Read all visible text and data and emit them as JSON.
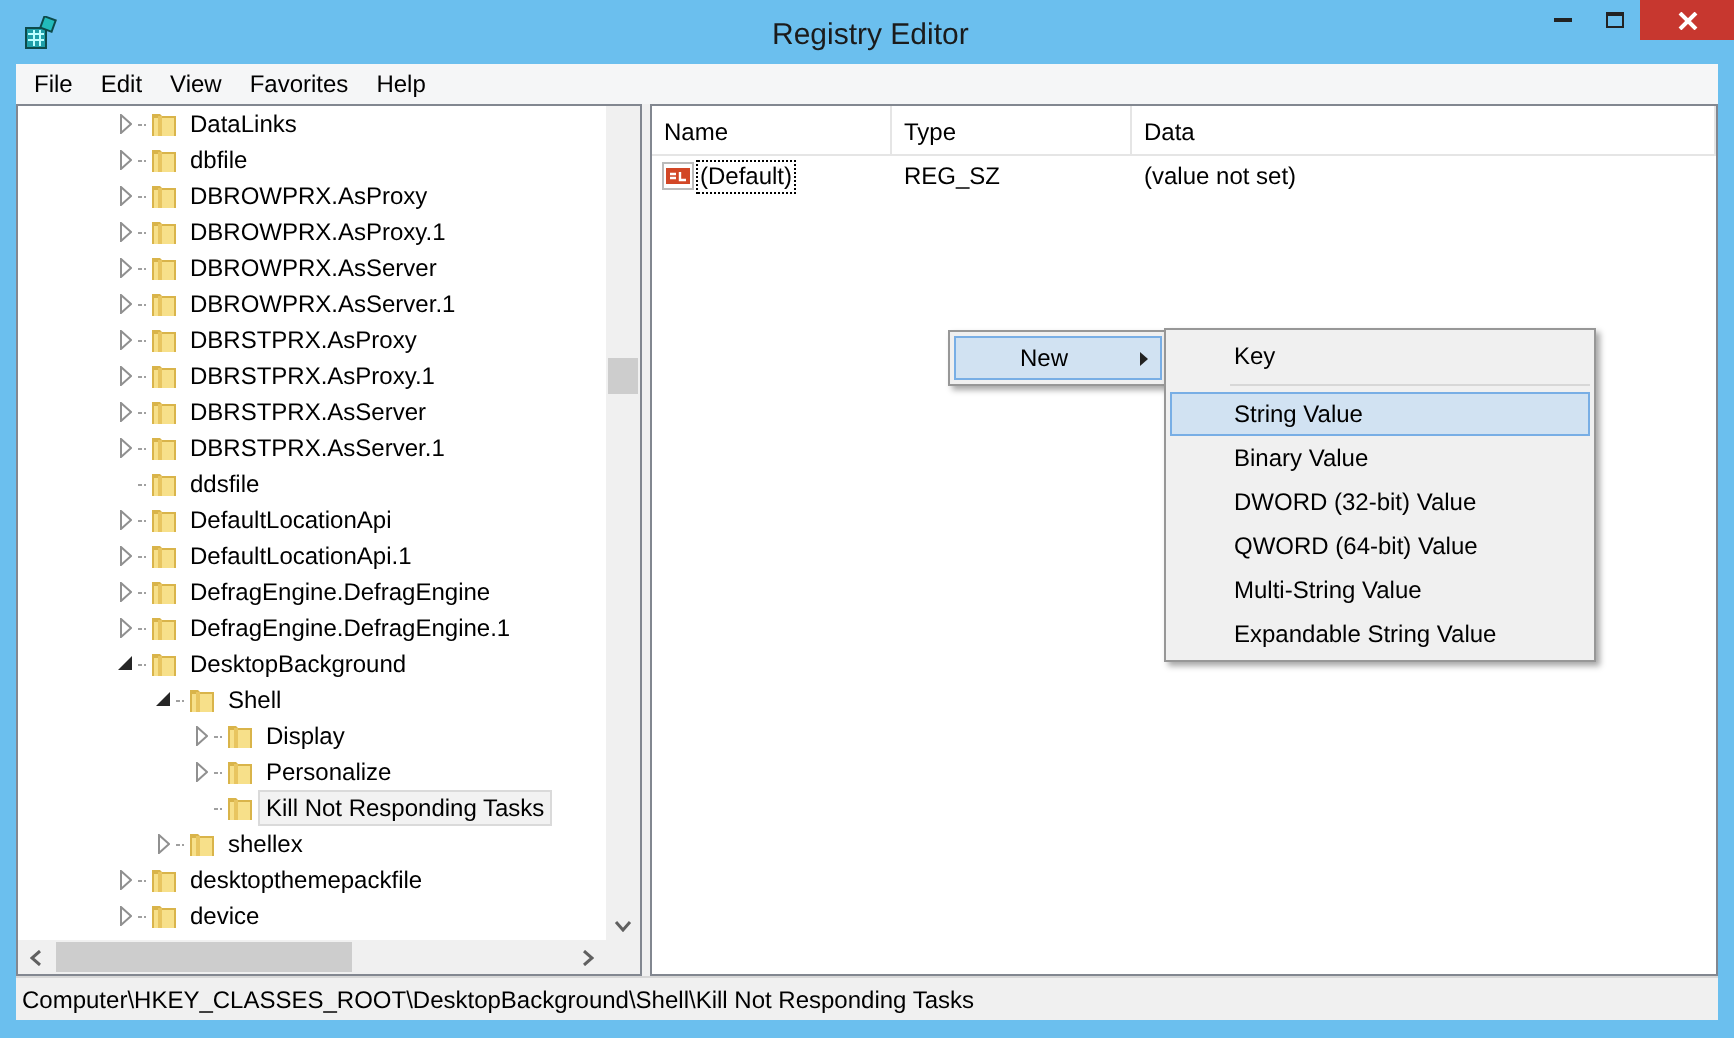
{
  "window": {
    "title": "Registry Editor"
  },
  "menu_bar": [
    "File",
    "Edit",
    "View",
    "Favorites",
    "Help"
  ],
  "tree": {
    "items": [
      {
        "label": "DataLinks",
        "expanded": false,
        "selected": false
      },
      {
        "label": "dbfile",
        "expanded": false,
        "selected": false
      },
      {
        "label": "DBROWPRX.AsProxy",
        "expanded": false,
        "selected": false
      },
      {
        "label": "DBROWPRX.AsProxy.1",
        "expanded": false,
        "selected": false
      },
      {
        "label": "DBROWPRX.AsServer",
        "expanded": false,
        "selected": false
      },
      {
        "label": "DBROWPRX.AsServer.1",
        "expanded": false,
        "selected": false
      },
      {
        "label": "DBRSTPRX.AsProxy",
        "expanded": false,
        "selected": false
      },
      {
        "label": "DBRSTPRX.AsProxy.1",
        "expanded": false,
        "selected": false
      },
      {
        "label": "DBRSTPRX.AsServer",
        "expanded": false,
        "selected": false
      },
      {
        "label": "DBRSTPRX.AsServer.1",
        "expanded": false,
        "selected": false
      },
      {
        "label": "ddsfile",
        "selected": false
      },
      {
        "label": "DefaultLocationApi",
        "expanded": false,
        "selected": false
      },
      {
        "label": "DefaultLocationApi.1",
        "expanded": false,
        "selected": false
      },
      {
        "label": "DefragEngine.DefragEngine",
        "expanded": false,
        "selected": false
      },
      {
        "label": "DefragEngine.DefragEngine.1",
        "expanded": false,
        "selected": false
      },
      {
        "label": "DesktopBackground",
        "expanded": true,
        "selected": false,
        "children": [
          {
            "label": "Shell",
            "expanded": true,
            "selected": false,
            "children": [
              {
                "label": "Display",
                "expanded": false,
                "selected": false
              },
              {
                "label": "Personalize",
                "expanded": false,
                "selected": false
              },
              {
                "label": "Kill Not Responding Tasks",
                "selected": true
              }
            ]
          },
          {
            "label": "shellex",
            "expanded": false,
            "selected": false
          }
        ]
      },
      {
        "label": "desktopthemepackfile",
        "expanded": false,
        "selected": false
      },
      {
        "label": "device",
        "expanded": false,
        "selected": false
      }
    ]
  },
  "table": {
    "columns": [
      "Name",
      "Type",
      "Data"
    ],
    "rows": [
      {
        "name": "(Default)",
        "type": "REG_SZ",
        "data": "(value not set)"
      }
    ]
  },
  "context_menu": {
    "items": [
      {
        "label": "New",
        "selected": true
      }
    ]
  },
  "submenu": {
    "items": [
      {
        "label": "Key",
        "selected": false,
        "separator_after": true
      },
      {
        "label": "String Value",
        "selected": true,
        "separator_after": false
      },
      {
        "label": "Binary Value",
        "selected": false,
        "separator_after": false
      },
      {
        "label": "DWORD (32-bit) Value",
        "selected": false,
        "separator_after": false
      },
      {
        "label": "QWORD (64-bit) Value",
        "selected": false,
        "separator_after": false
      },
      {
        "label": "Multi-String Value",
        "selected": false,
        "separator_after": false
      },
      {
        "label": "Expandable String Value",
        "selected": false,
        "separator_after": false
      }
    ]
  },
  "status_bar": "Computer\\HKEY_CLASSES_ROOT\\DesktopBackground\\Shell\\Kill Not Responding Tasks"
}
